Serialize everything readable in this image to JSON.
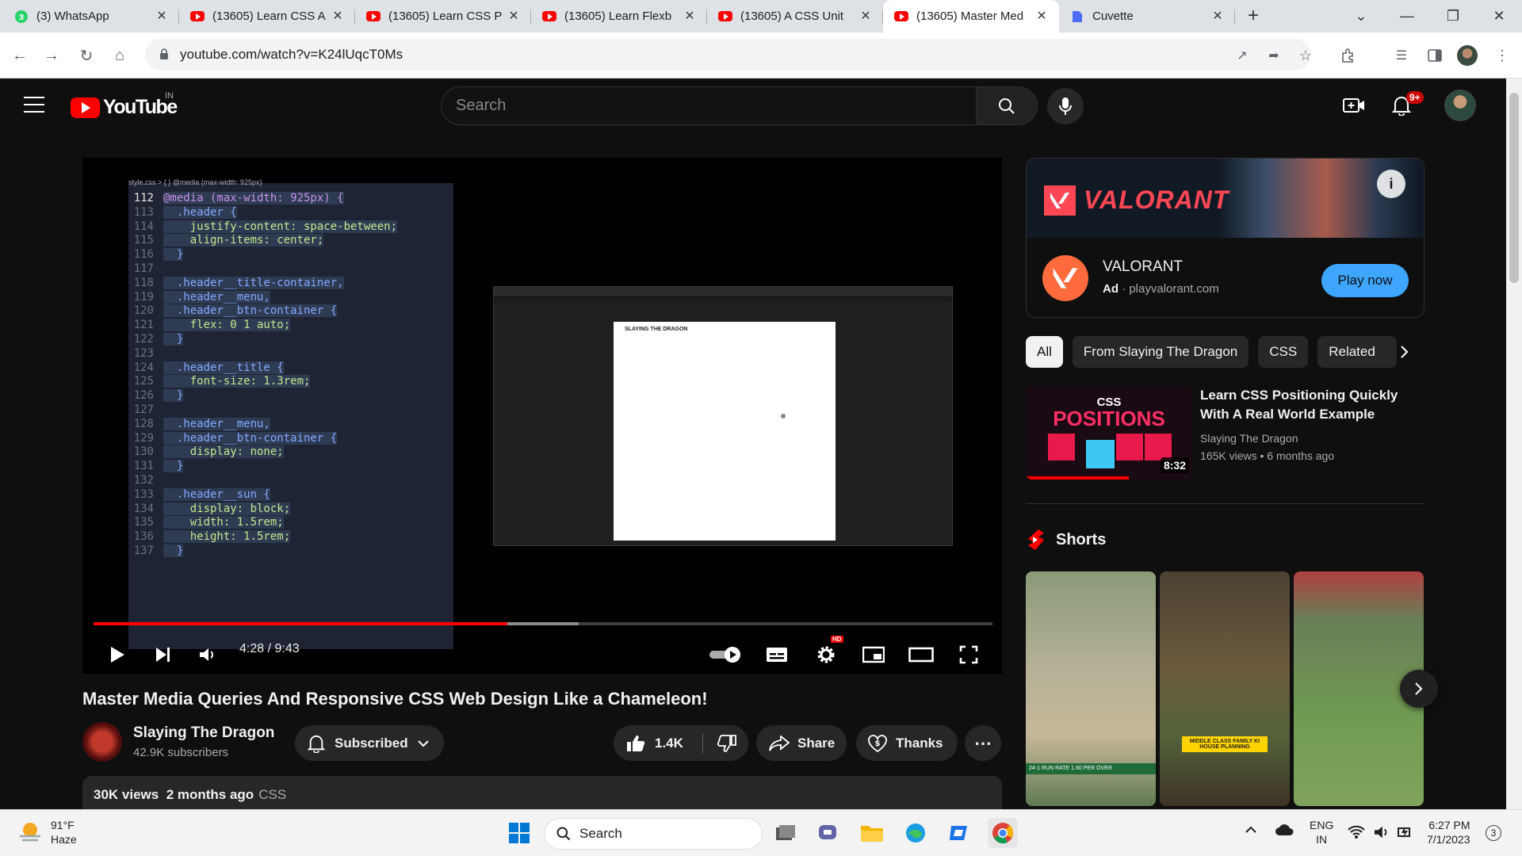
{
  "browser": {
    "tabs": [
      {
        "label": "(3) WhatsApp",
        "icon": "whatsapp-icon",
        "active": false
      },
      {
        "label": "(13605) Learn CSS A",
        "icon": "youtube-icon",
        "active": false
      },
      {
        "label": "(13605) Learn CSS P",
        "icon": "youtube-icon",
        "active": false
      },
      {
        "label": "(13605) Learn Flexb",
        "icon": "youtube-icon",
        "active": false
      },
      {
        "label": "(13605) A CSS Unit",
        "icon": "youtube-icon",
        "active": false
      },
      {
        "label": "(13605) Master Med",
        "icon": "youtube-icon",
        "active": true
      },
      {
        "label": "Cuvette",
        "icon": "cuvette-icon",
        "active": false
      }
    ],
    "url": "youtube.com/watch?v=K24lUqcT0Ms"
  },
  "header": {
    "logo_text": "YouTube",
    "country_code": "IN",
    "search_placeholder": "Search",
    "notification_count": "9+"
  },
  "player": {
    "code_header": "style.css > { } @media (max-width: 925px)",
    "code_lines": [
      {
        "n": "112",
        "t": "@media (max-width: 925px) {"
      },
      {
        "n": "113",
        "t": "  .header {"
      },
      {
        "n": "114",
        "t": "    justify-content: space-between;"
      },
      {
        "n": "115",
        "t": "    align-items: center;"
      },
      {
        "n": "116",
        "t": "  }"
      },
      {
        "n": "117",
        "t": ""
      },
      {
        "n": "118",
        "t": "  .header__title-container,"
      },
      {
        "n": "119",
        "t": "  .header__menu,"
      },
      {
        "n": "120",
        "t": "  .header__btn-container {"
      },
      {
        "n": "121",
        "t": "    flex: 0 1 auto;"
      },
      {
        "n": "122",
        "t": "  }"
      },
      {
        "n": "123",
        "t": ""
      },
      {
        "n": "124",
        "t": "  .header__title {"
      },
      {
        "n": "125",
        "t": "    font-size: 1.3rem;"
      },
      {
        "n": "126",
        "t": "  }"
      },
      {
        "n": "127",
        "t": ""
      },
      {
        "n": "128",
        "t": "  .header__menu,"
      },
      {
        "n": "129",
        "t": "  .header__btn-container {"
      },
      {
        "n": "130",
        "t": "    display: none;"
      },
      {
        "n": "131",
        "t": "  }"
      },
      {
        "n": "132",
        "t": ""
      },
      {
        "n": "133",
        "t": "  .header__sun {"
      },
      {
        "n": "134",
        "t": "    display: block;"
      },
      {
        "n": "135",
        "t": "    width: 1.5rem;"
      },
      {
        "n": "136",
        "t": "    height: 1.5rem;"
      },
      {
        "n": "137",
        "t": "  }"
      }
    ],
    "inner_canvas_title": "SLAYING THE DRAGON",
    "time": "4:28 / 9:43",
    "progress_fraction": 0.46,
    "buffered_fraction": 0.54,
    "hd_badge": "HD"
  },
  "video": {
    "title": "Master Media Queries And Responsive CSS Web Design Like a Chameleon!",
    "channel": "Slaying The Dragon",
    "subscribers": "42.9K subscribers",
    "subscribe_label": "Subscribed",
    "likes": "1.4K",
    "share_label": "Share",
    "thanks_label": "Thanks",
    "views": "30K views",
    "date": "2 months ago",
    "tag": "CSS"
  },
  "ad": {
    "banner_brand": "VALORANT",
    "name": "VALORANT",
    "ad_label": "Ad",
    "domain": "playvalorant.com",
    "cta": "Play now"
  },
  "chips": [
    "All",
    "From Slaying The Dragon",
    "CSS",
    "Related"
  ],
  "recommended": {
    "thumb_line1": "CSS",
    "thumb_line2": "POSITIONS",
    "duration": "8:32",
    "title": "Learn CSS Positioning Quickly With A Real World Example",
    "channel": "Slaying The Dragon",
    "meta": "165K views • 6 months ago"
  },
  "shorts": {
    "heading": "Shorts",
    "caption2": "MIDDLE CLASS FAMILY KI HOUSE PLANNING",
    "score1": "24-1  RUN RATE 1.60 PER OVER"
  },
  "taskbar": {
    "temp": "91°F",
    "condition": "Haze",
    "search_label": "Search",
    "lang1": "ENG",
    "lang2": "IN",
    "time": "6:27 PM",
    "date": "7/1/2023",
    "notif_count": "3"
  }
}
